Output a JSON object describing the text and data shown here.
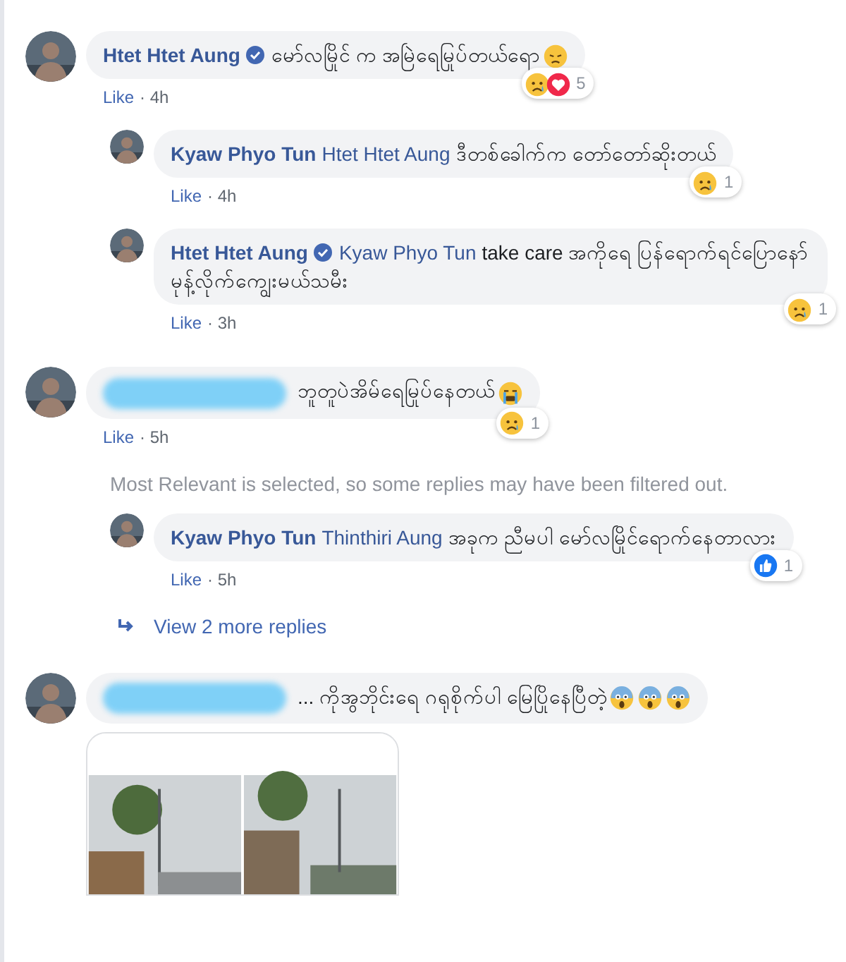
{
  "comments": [
    {
      "author": {
        "name": "Htet Htet Aung",
        "verified": true
      },
      "text": "မော်လမြိုင် က အမြဲရေမြုပ်တယ်ရော",
      "emoji": [
        {
          "kind": "disappointed"
        }
      ],
      "reactions": [
        {
          "kind": "sad"
        },
        {
          "kind": "love"
        }
      ],
      "reaction_count": "5",
      "like": "Like",
      "time": "· 4h",
      "replies": [
        {
          "kind": "reply",
          "author": {
            "name": "Kyaw Phyo Tun"
          },
          "tag": "Htet Htet Aung",
          "text": "ဒီတစ်ခေါက်က တော်တော်ဆိုးတယ်",
          "reactions": [
            {
              "kind": "sad"
            }
          ],
          "reaction_count": "1",
          "like": "Like",
          "time": "· 4h"
        },
        {
          "kind": "reply",
          "author": {
            "name": "Htet Htet Aung",
            "verified": true
          },
          "tag": "Kyaw Phyo Tun",
          "text": "take care အကိုရေ ပြန်ရောက်ရင်ပြောနော် မုန့်လိုက်ကျွေးမယ်သမီး",
          "reactions": [
            {
              "kind": "sad"
            }
          ],
          "reaction_count": "1",
          "like": "Like",
          "time": "· 3h"
        }
      ]
    },
    {
      "author": {
        "redacted": true
      },
      "text": "ဘူတူပဲအိမ်ရေမြုပ်နေတယ်",
      "emoji": [
        {
          "kind": "crying"
        }
      ],
      "reactions": [
        {
          "kind": "sad"
        }
      ],
      "reaction_count": "1",
      "like": "Like",
      "time": "· 5h",
      "replies": [
        {
          "kind": "notice",
          "text": "Most Relevant is selected, so some replies may have been filtered out."
        },
        {
          "kind": "reply",
          "author": {
            "name": "Kyaw Phyo Tun"
          },
          "tag": "Thinthiri Aung",
          "text": "အခုက ညီမပါ မော်လမြိုင်ရောက်နေတာလား",
          "reactions": [
            {
              "kind": "like"
            }
          ],
          "reaction_count": "1",
          "like": "Like",
          "time": "· 5h"
        },
        {
          "kind": "more",
          "text": "View 2 more replies"
        }
      ]
    },
    {
      "author": {
        "redacted": true
      },
      "text": "... ကိုအွဘိုင်းရေ ဂရုစိုက်ပါ မြေပြိုနေပြီတဲ့",
      "emoji": [
        {
          "kind": "scream"
        },
        {
          "kind": "scream"
        },
        {
          "kind": "scream"
        }
      ]
    }
  ]
}
